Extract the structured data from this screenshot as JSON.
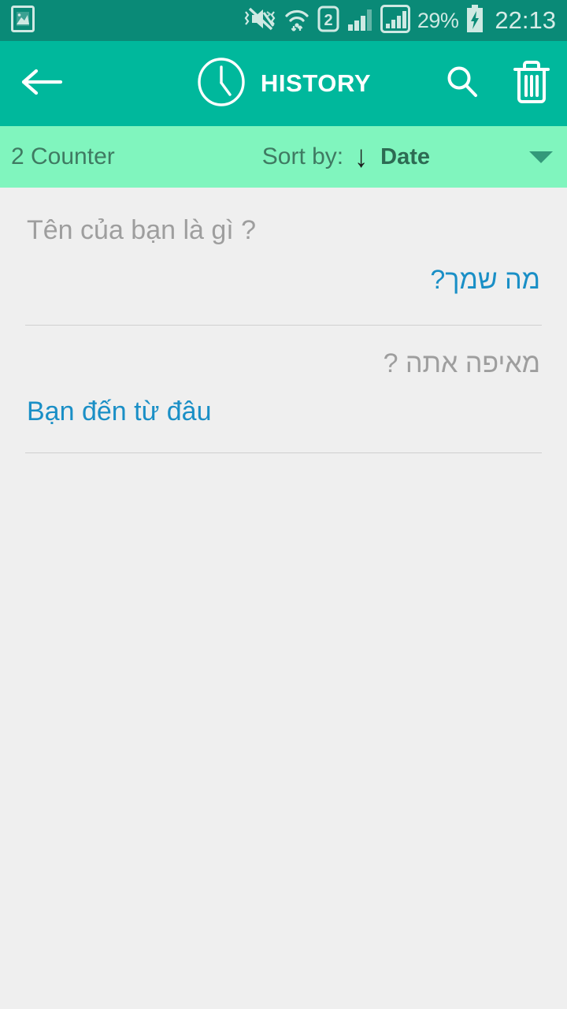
{
  "status_bar": {
    "background": "#0a8a77",
    "notification_icon": "image-icon",
    "icons": [
      "mute-vibrate-icon",
      "wifi-icon",
      "sim2-icon",
      "signal-bars-icon",
      "signal-bars-boxed-icon"
    ],
    "battery_percent": "29%",
    "battery_state": "charging",
    "time": "22:13"
  },
  "app_bar": {
    "background": "#00b89c",
    "back_icon": "arrow-left-icon",
    "clock_icon": "clock-icon",
    "title": "HISTORY",
    "search_icon": "search-icon",
    "delete_icon": "trash-icon"
  },
  "sort_bar": {
    "background": "#80f5be",
    "counter": "2 Counter",
    "sort_label": "Sort by:",
    "sort_direction_icon": "arrow-down-icon",
    "sort_value": "Date",
    "dropdown_icon": "caret-down-icon"
  },
  "colors": {
    "source_text": "#9e9e9e",
    "translation_text": "#1a8fc6",
    "page_background": "#efefef",
    "divider": "#cfcfcf"
  },
  "history": {
    "items": [
      {
        "source": "Tên của bạn là gì ?",
        "source_dir": "ltr",
        "translation": "מה שמך?",
        "translation_dir": "rtl"
      },
      {
        "source": "מאיפה אתה ?",
        "source_dir": "rtl",
        "translation": "Bạn đến từ đâu",
        "translation_dir": "ltr"
      }
    ]
  }
}
